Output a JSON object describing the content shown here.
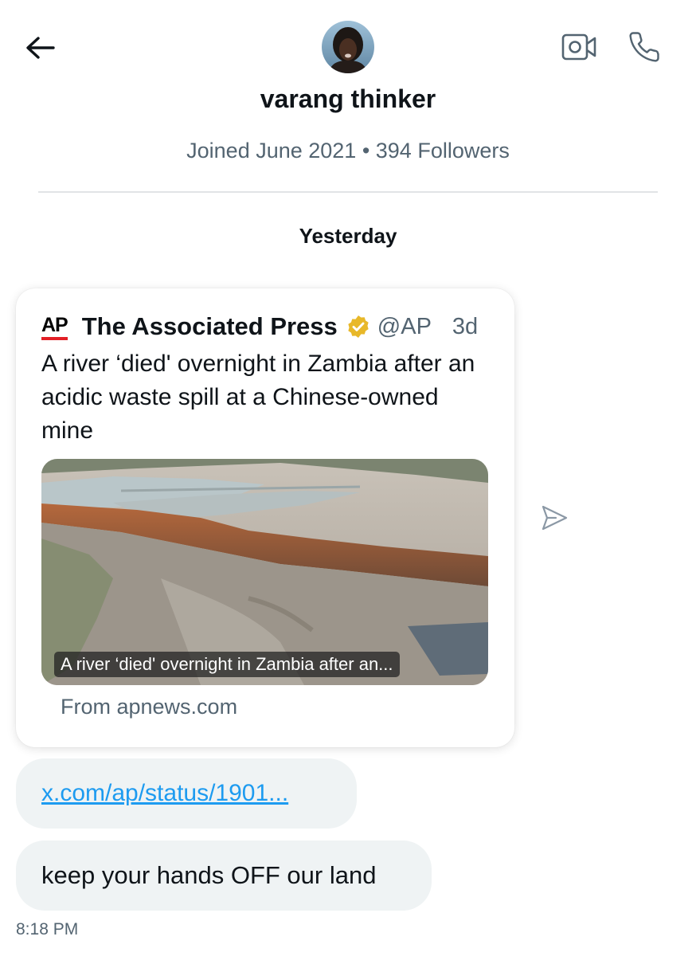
{
  "header": {
    "name": "varang thinker",
    "meta": "Joined June 2021 • 394 Followers"
  },
  "icons": {
    "back": "arrow-left-icon",
    "video": "video-camera-icon",
    "call": "phone-icon",
    "share": "send-icon",
    "verified": "verified-badge-icon"
  },
  "conversation": {
    "day_separator": "Yesterday",
    "shared_post": {
      "logo": "AP",
      "author": "The Associated Press",
      "handle": "@AP",
      "time": "3d",
      "text": "A river ‘died' overnight in Zambia after an acidic waste spill at a Chinese-owned mine",
      "media_caption": "A river ‘died' overnight in Zambia after an...",
      "source": "From apnews.com"
    },
    "link_message": "x.com/ap/status/1901...",
    "text_message": "keep your hands OFF our land",
    "timestamp": "8:18 PM"
  },
  "colors": {
    "text_primary": "#0f1419",
    "text_secondary": "#536471",
    "link": "#1d9bf0",
    "bubble": "#eff3f4",
    "ap_red": "#e21f26",
    "verified_gold": "#e8b829"
  }
}
